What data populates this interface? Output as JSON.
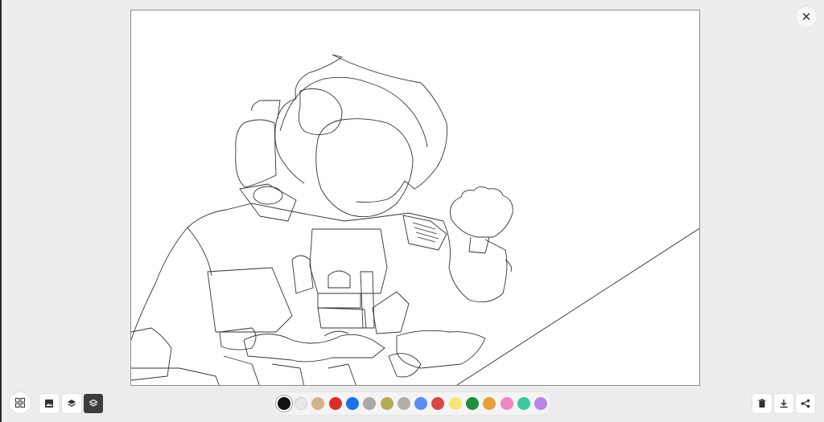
{
  "toolbar_left": {
    "grid": {
      "icon": "grid-icon"
    },
    "buttons": [
      {
        "name": "image-button",
        "icon": "image-icon"
      },
      {
        "name": "layers-button",
        "icon": "layers-icon"
      },
      {
        "name": "layers-active-button",
        "icon": "layers-stack-icon",
        "active": true
      }
    ]
  },
  "palette": {
    "colors": [
      "#111111",
      "#e8e8e8",
      "#d2b48c",
      "#d93025",
      "#1a73e8",
      "#a9a9a9",
      "#b5ac55",
      "#b0b0a6",
      "#5b8def",
      "#d94545",
      "#f3e77a",
      "#1e8e3e",
      "#e6a040",
      "#ef86c2",
      "#3cc9a0",
      "#b784e8"
    ],
    "selected_index": 0
  },
  "toolbar_right": [
    {
      "name": "delete-button",
      "icon": "trash-icon"
    },
    {
      "name": "download-button",
      "icon": "download-icon"
    },
    {
      "name": "share-button",
      "icon": "share-icon"
    }
  ],
  "window": {
    "close_icon": "close-icon"
  }
}
